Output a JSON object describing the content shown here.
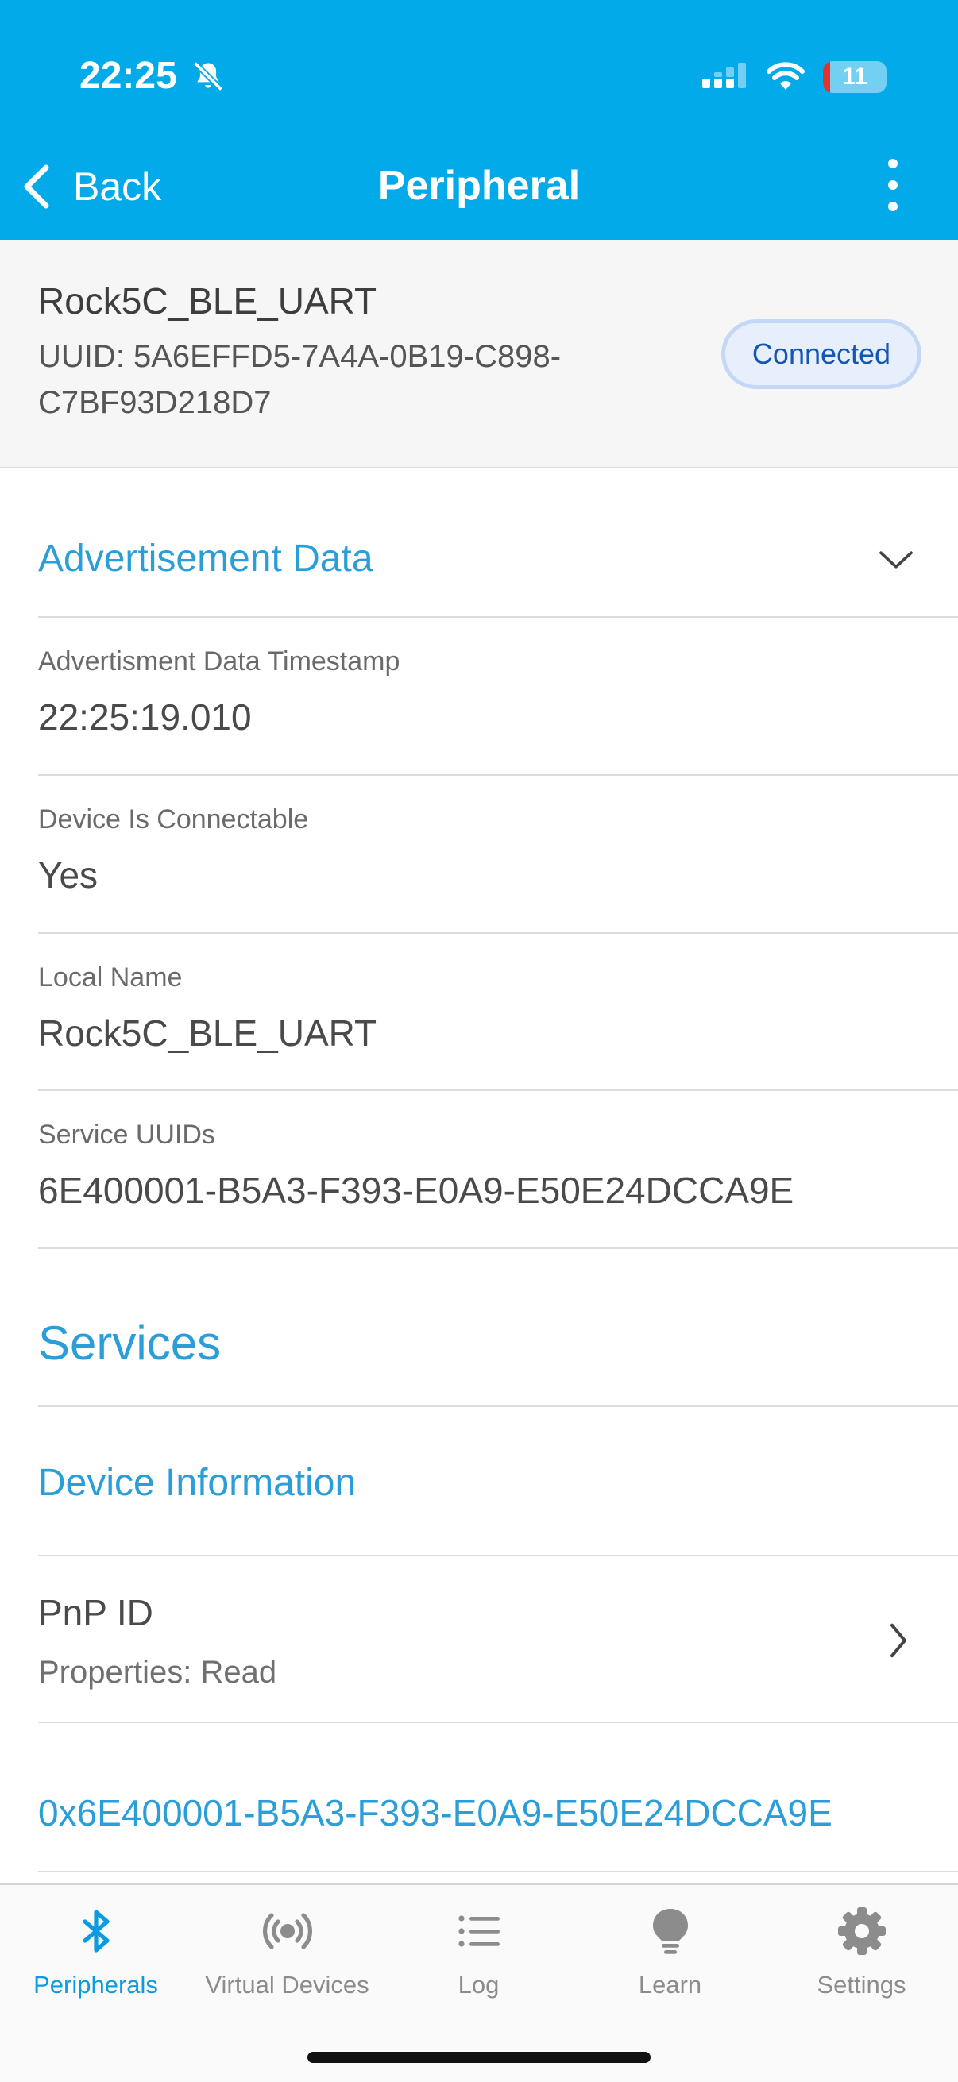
{
  "status_bar": {
    "time": "22:25",
    "battery": "11",
    "battery_level": 0.11
  },
  "nav": {
    "back_label": "Back",
    "title": "Peripheral"
  },
  "device": {
    "name": "Rock5C_BLE_UART",
    "uuid": "UUID: 5A6EFFD5-7A4A-0B19-C898-C7BF93D218D7",
    "status": "Connected"
  },
  "advertisement": {
    "heading": "Advertisement Data",
    "fields": [
      {
        "label": "Advertisment Data Timestamp",
        "value": "22:25:19.010"
      },
      {
        "label": "Device Is Connectable",
        "value": "Yes"
      },
      {
        "label": "Local Name",
        "value": "Rock5C_BLE_UART"
      },
      {
        "label": "Service UUIDs",
        "value": "6E400001-B5A3-F393-E0A9-E50E24DCCA9E"
      }
    ]
  },
  "services": {
    "heading": "Services",
    "groups": [
      {
        "name": "Device Information",
        "characteristics": [
          {
            "name": "PnP ID",
            "properties": "Properties: Read"
          }
        ]
      },
      {
        "name": "0x6E400001-B5A3-F393-E0A9-E50E24DCCA9E"
      }
    ]
  },
  "tabs": [
    {
      "label": "Peripherals",
      "icon": "bluetooth-icon",
      "active": true
    },
    {
      "label": "Virtual Devices",
      "icon": "broadcast-icon",
      "active": false
    },
    {
      "label": "Log",
      "icon": "list-icon",
      "active": false
    },
    {
      "label": "Learn",
      "icon": "lightbulb-icon",
      "active": false
    },
    {
      "label": "Settings",
      "icon": "gear-icon",
      "active": false
    }
  ],
  "colors": {
    "header": "#02aaea",
    "accent": "#2a9ed9",
    "badge_text": "#1456b3",
    "tab_active": "#0a9be0",
    "tab_inactive": "#8c8c8c"
  }
}
